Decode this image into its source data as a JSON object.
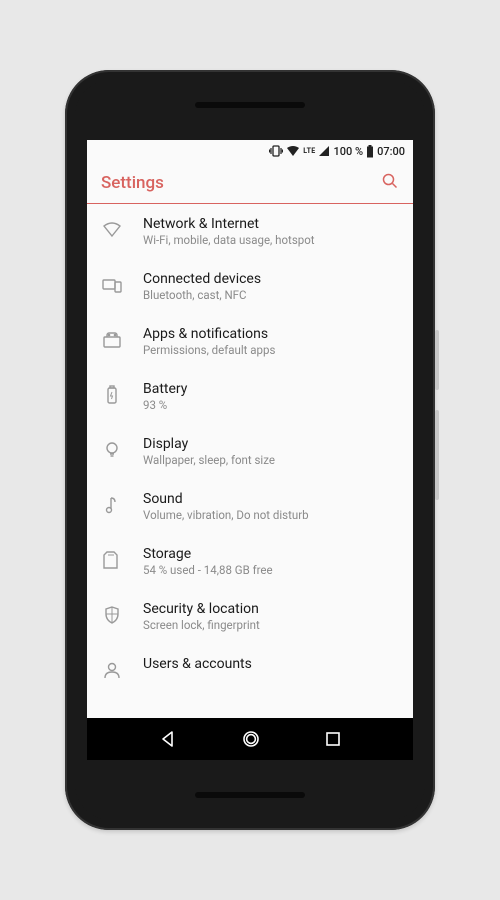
{
  "statusbar": {
    "percent": "100 %",
    "time": "07:00",
    "lte_label": "LTE"
  },
  "appbar": {
    "title": "Settings"
  },
  "items": [
    {
      "title": "Network & Internet",
      "sub": "Wi-Fi, mobile, data usage, hotspot"
    },
    {
      "title": "Connected devices",
      "sub": "Bluetooth, cast, NFC"
    },
    {
      "title": "Apps & notifications",
      "sub": "Permissions, default apps"
    },
    {
      "title": "Battery",
      "sub": "93 %"
    },
    {
      "title": "Display",
      "sub": "Wallpaper, sleep, font size"
    },
    {
      "title": "Sound",
      "sub": "Volume, vibration, Do not disturb"
    },
    {
      "title": "Storage",
      "sub": "54 % used - 14,88 GB free"
    },
    {
      "title": "Security & location",
      "sub": "Screen lock, fingerprint"
    },
    {
      "title": "Users & accounts",
      "sub": ""
    }
  ]
}
